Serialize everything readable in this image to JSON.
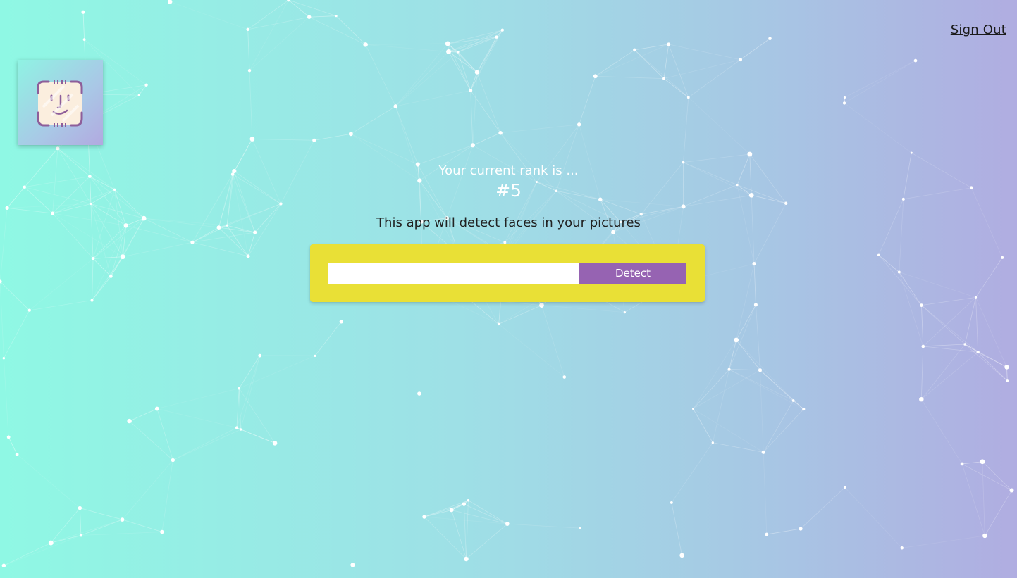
{
  "nav": {
    "sign_out_label": "Sign Out"
  },
  "logo": {
    "icon": "face-scan-icon"
  },
  "rank": {
    "label": "Your current rank is ...",
    "value": "#5"
  },
  "tagline": "This app will detect faces in your pictures",
  "form": {
    "image_url_value": "",
    "detect_label": "Detect"
  },
  "colors": {
    "accent_yellow": "#e9e036",
    "button_purple": "#9663b2",
    "gradient_left": "#8ff8e4",
    "gradient_right": "#b0ade1"
  }
}
